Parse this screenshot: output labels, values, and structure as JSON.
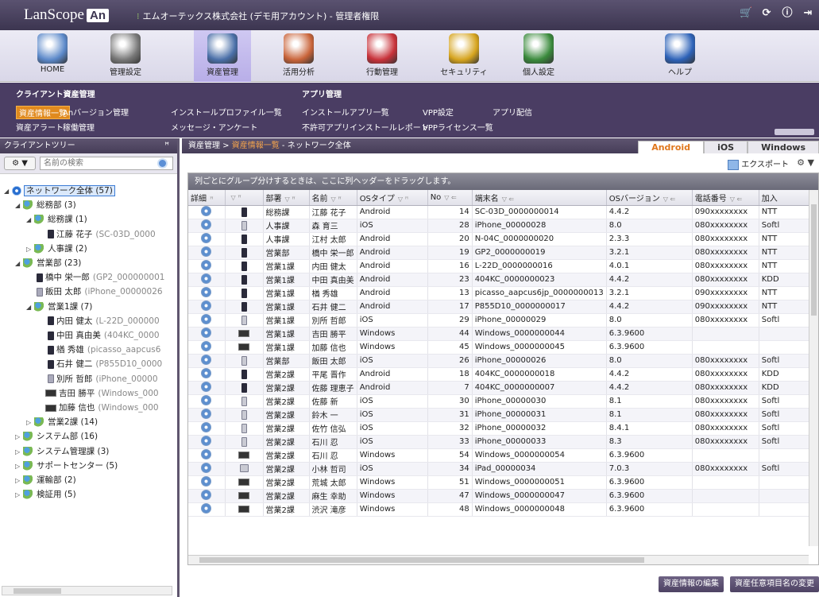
{
  "app": {
    "logo_text": "LanScope",
    "logo_badge": "An",
    "company": "エムオーテックス株式会社 (デモ用アカウント) - 管理者権限"
  },
  "topicons": [
    "cart-icon",
    "refresh-icon",
    "info-icon",
    "logout-icon"
  ],
  "nav": [
    {
      "label": "HOME",
      "icon": "home-icon",
      "color": "#5b88c9"
    },
    {
      "label": "管理設定",
      "icon": "settings-icon",
      "color": "#777"
    },
    {
      "label": "資産管理",
      "icon": "asset-search-icon",
      "color": "#4a6fa8",
      "active": true
    },
    {
      "label": "活用分析",
      "icon": "analysis-icon",
      "color": "#c9643a"
    },
    {
      "label": "行動管理",
      "icon": "location-icon",
      "color": "#c8323a"
    },
    {
      "label": "セキュリティ",
      "icon": "lock-icon",
      "color": "#d6a41e"
    },
    {
      "label": "個人設定",
      "icon": "person-icon",
      "color": "#3a8a3c"
    },
    {
      "label": "ヘルプ",
      "icon": "help-icon",
      "color": "#2d62b8"
    }
  ],
  "submenu": {
    "client_header": "クライアント資産管理",
    "app_header": "アプリ管理",
    "items_row1": [
      "資産情報一覧",
      "Anバージョン管理",
      "インストールプロファイル一覧",
      "インストールアプリ一覧",
      "VPP設定",
      "アプリ配信"
    ],
    "items_row2": [
      "資産アラート",
      "稼働管理",
      "メッセージ・アンケート",
      "不許可アプリインストールレポート",
      "VPPライセンス一覧"
    ]
  },
  "left": {
    "title": "クライアントツリー",
    "pin": "ꟸ",
    "gear_label": "▼",
    "search_placeholder": "名前の検索",
    "tree": [
      {
        "level": 0,
        "tog": "◢",
        "icon": "root",
        "label": "ネットワーク全体 (57)",
        "root": true
      },
      {
        "level": 1,
        "tog": "◢",
        "icon": "ppl",
        "label": "総務部 (3)"
      },
      {
        "level": 2,
        "tog": "◢",
        "icon": "ppl",
        "label": "総務課 (1)"
      },
      {
        "level": 3,
        "tog": "",
        "icon": "dev",
        "label": "江藤 花子",
        "sub": "(SC-03D_0000"
      },
      {
        "level": 2,
        "tog": "▷",
        "icon": "ppl",
        "label": "人事課 (2)"
      },
      {
        "level": 1,
        "tog": "◢",
        "icon": "ppl",
        "label": "営業部 (23)"
      },
      {
        "level": 2,
        "tog": "",
        "icon": "dev",
        "label": "橋中 栄一郎",
        "sub": "(GP2_000000001"
      },
      {
        "level": 2,
        "tog": "",
        "icon": "devl",
        "label": "飯田 太郎",
        "sub": "(iPhone_00000026"
      },
      {
        "level": 2,
        "tog": "◢",
        "icon": "ppl",
        "label": "営業1課 (7)"
      },
      {
        "level": 3,
        "tog": "",
        "icon": "dev",
        "label": "内田 健太",
        "sub": "(L-22D_000000"
      },
      {
        "level": 3,
        "tog": "",
        "icon": "dev",
        "label": "中田 真由美",
        "sub": "(404KC_0000"
      },
      {
        "level": 3,
        "tog": "",
        "icon": "dev",
        "label": "楢 秀雄",
        "sub": "(picasso_aapcus6"
      },
      {
        "level": 3,
        "tog": "",
        "icon": "dev",
        "label": "石井 健二",
        "sub": "(P855D10_0000"
      },
      {
        "level": 3,
        "tog": "",
        "icon": "devl",
        "label": "別所 哲郎",
        "sub": "(iPhone_00000"
      },
      {
        "level": 3,
        "tog": "",
        "icon": "devpc",
        "label": "吉田 勝平",
        "sub": "(Windows_000"
      },
      {
        "level": 3,
        "tog": "",
        "icon": "devpc",
        "label": "加藤 信也",
        "sub": "(Windows_000"
      },
      {
        "level": 2,
        "tog": "▷",
        "icon": "ppl",
        "label": "営業2課 (14)"
      },
      {
        "level": 1,
        "tog": "▷",
        "icon": "ppl",
        "label": "システム部 (16)"
      },
      {
        "level": 1,
        "tog": "▷",
        "icon": "ppl",
        "label": "システム管理課 (3)"
      },
      {
        "level": 1,
        "tog": "▷",
        "icon": "ppl",
        "label": "サポートセンター (5)"
      },
      {
        "level": 1,
        "tog": "▷",
        "icon": "ppl",
        "label": "運輸部 (2)"
      },
      {
        "level": 1,
        "tog": "▷",
        "icon": "ppl",
        "label": "検証用 (5)"
      }
    ]
  },
  "main": {
    "crumb_home": "資産管理 >",
    "crumb_link": "資産情報一覧",
    "crumb_rest": " - ネットワーク全体",
    "tabs": [
      "Android",
      "iOS",
      "Windows"
    ],
    "export": "エクスポート",
    "grid_gear": "⚙ ▼",
    "group_hint": "列ごとにグループ分けするときは、ここに列ヘッダーをドラッグします。",
    "headers": [
      "詳細",
      "",
      "部署",
      "名前",
      "OSタイプ",
      "No",
      "端末名",
      "OSバージョン",
      "電話番号",
      "加入"
    ],
    "rows": [
      [
        "a",
        "総務課",
        "江藤 花子",
        "Android",
        "14",
        "SC-03D_0000000014",
        "4.4.2",
        "090xxxxxxxx",
        "NTT"
      ],
      [
        "i",
        "人事課",
        "森 育三",
        "iOS",
        "28",
        "iPhone_00000028",
        "8.0",
        "080xxxxxxxx",
        "Softl"
      ],
      [
        "a",
        "人事課",
        "江村 太郎",
        "Android",
        "20",
        "N-04C_0000000020",
        "2.3.3",
        "080xxxxxxxx",
        "NTT"
      ],
      [
        "a",
        "営業部",
        "橋中 栄一郎",
        "Android",
        "19",
        "GP2_0000000019",
        "3.2.1",
        "080xxxxxxxx",
        "NTT"
      ],
      [
        "a",
        "営業1課",
        "内田 健太",
        "Android",
        "16",
        "L-22D_0000000016",
        "4.0.1",
        "080xxxxxxxx",
        "NTT"
      ],
      [
        "a",
        "営業1課",
        "中田 真由美",
        "Android",
        "23",
        "404KC_0000000023",
        "4.4.2",
        "080xxxxxxxx",
        "KDD"
      ],
      [
        "a",
        "営業1課",
        "楢 秀雄",
        "Android",
        "13",
        "picasso_aapcus6jp_0000000013",
        "3.2.1",
        "090xxxxxxxx",
        "NTT"
      ],
      [
        "a",
        "営業1課",
        "石井 健二",
        "Android",
        "17",
        "P855D10_0000000017",
        "4.4.2",
        "090xxxxxxxx",
        "NTT"
      ],
      [
        "i",
        "営業1課",
        "別所 哲郎",
        "iOS",
        "29",
        "iPhone_00000029",
        "8.0",
        "080xxxxxxxx",
        "Softl"
      ],
      [
        "w",
        "営業1課",
        "吉田 勝平",
        "Windows",
        "44",
        "Windows_0000000044",
        "6.3.9600",
        "",
        ""
      ],
      [
        "w",
        "営業1課",
        "加藤 信也",
        "Windows",
        "45",
        "Windows_0000000045",
        "6.3.9600",
        "",
        ""
      ],
      [
        "i",
        "営業部",
        "飯田 太郎",
        "iOS",
        "26",
        "iPhone_00000026",
        "8.0",
        "080xxxxxxxx",
        "Softl"
      ],
      [
        "a",
        "営業2課",
        "平尾 晋作",
        "Android",
        "18",
        "404KC_0000000018",
        "4.4.2",
        "080xxxxxxxx",
        "KDD"
      ],
      [
        "a",
        "営業2課",
        "佐藤 理恵子",
        "Android",
        "7",
        "404KC_0000000007",
        "4.4.2",
        "080xxxxxxxx",
        "KDD"
      ],
      [
        "i",
        "営業2課",
        "佐藤 新",
        "iOS",
        "30",
        "iPhone_00000030",
        "8.1",
        "080xxxxxxxx",
        "Softl"
      ],
      [
        "i",
        "営業2課",
        "鈴木 一",
        "iOS",
        "31",
        "iPhone_00000031",
        "8.1",
        "080xxxxxxxx",
        "Softl"
      ],
      [
        "i",
        "営業2課",
        "佐竹 信弘",
        "iOS",
        "32",
        "iPhone_00000032",
        "8.4.1",
        "080xxxxxxxx",
        "Softl"
      ],
      [
        "i",
        "営業2課",
        "石川 忍",
        "iOS",
        "33",
        "iPhone_00000033",
        "8.3",
        "080xxxxxxxx",
        "Softl"
      ],
      [
        "w",
        "営業2課",
        "石川 忍",
        "Windows",
        "54",
        "Windows_0000000054",
        "6.3.9600",
        "",
        ""
      ],
      [
        "p",
        "営業2課",
        "小林 哲司",
        "iOS",
        "34",
        "iPad_00000034",
        "7.0.3",
        "080xxxxxxxx",
        "Softl"
      ],
      [
        "w",
        "営業2課",
        "荒城 太郎",
        "Windows",
        "51",
        "Windows_0000000051",
        "6.3.9600",
        "",
        ""
      ],
      [
        "w",
        "営業2課",
        "麻生 幸助",
        "Windows",
        "47",
        "Windows_0000000047",
        "6.3.9600",
        "",
        ""
      ],
      [
        "w",
        "営業2課",
        "渋沢 滝彦",
        "Windows",
        "48",
        "Windows_0000000048",
        "6.3.9600",
        "",
        ""
      ]
    ],
    "buttons": [
      "資産情報の編集",
      "資産任意項目名の変更"
    ]
  }
}
